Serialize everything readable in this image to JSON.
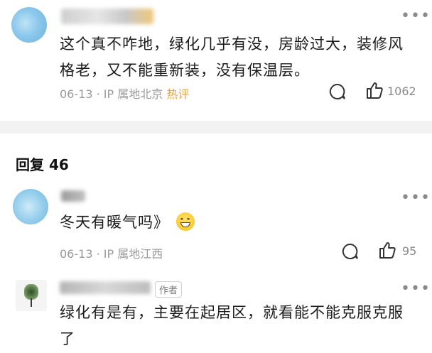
{
  "comment1": {
    "text": "这个真不咋地，绿化几乎有没，房龄过大，装修风格老，又不能重新装，没有保温层。",
    "date": "06-13",
    "location": "· IP 属地北京",
    "tag": "热评",
    "likes": "1062"
  },
  "replies": {
    "header": "回复 46"
  },
  "reply1": {
    "text": "冬天有暖气吗》",
    "emoji": "😄",
    "date": "06-13",
    "location": "· IP 属地江西",
    "likes": "95"
  },
  "reply2": {
    "badge": "作者",
    "text": "绿化有是有，主要在起居区，就看能不能克服克服了"
  },
  "icons": {
    "more": "more-dots-icon",
    "comment": "comment-bubble-icon",
    "like": "thumbs-up-icon"
  }
}
